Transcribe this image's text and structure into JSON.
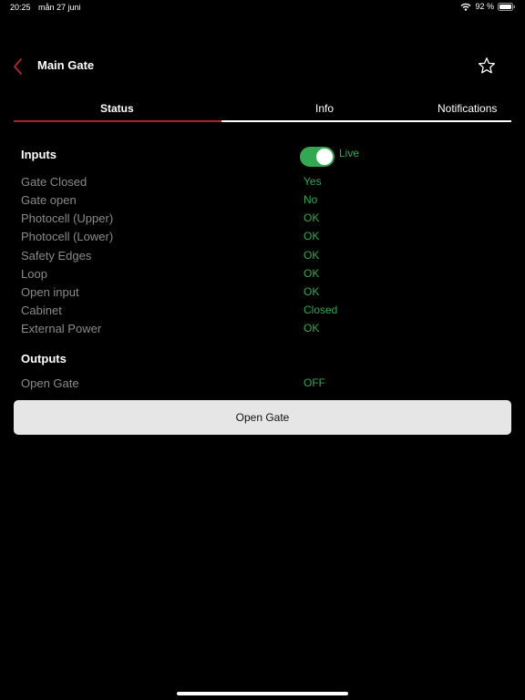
{
  "status_bar": {
    "time": "20:25",
    "date": "mån 27 juni",
    "battery_percent": "92 %",
    "icons": [
      "wifi-icon",
      "battery-icon"
    ]
  },
  "navbar": {
    "title": "Main Gate",
    "icons": [
      "chevron-left-icon",
      "star-icon"
    ],
    "accent_color": "#b0222d"
  },
  "tabs": [
    {
      "label": "Status",
      "selected": true
    },
    {
      "label": "Info",
      "selected": false
    },
    {
      "label": "Notifications",
      "selected": false
    }
  ],
  "inputs": {
    "title": "Inputs",
    "live_toggle_on": true,
    "live_label": "Live",
    "rows": [
      {
        "label": "Gate Closed",
        "value": "Yes"
      },
      {
        "label": "Gate open",
        "value": "No"
      },
      {
        "label": "Photocell (Upper)",
        "value": "OK"
      },
      {
        "label": "Photocell (Lower)",
        "value": "OK"
      },
      {
        "label": "Safety Edges",
        "value": "OK"
      },
      {
        "label": "Loop",
        "value": "OK"
      },
      {
        "label": "Open input",
        "value": "OK"
      },
      {
        "label": "Cabinet",
        "value": "Closed"
      },
      {
        "label": "External Power",
        "value": "OK"
      }
    ]
  },
  "outputs": {
    "title": "Outputs",
    "rows": [
      {
        "label": "Open Gate",
        "value": "OFF"
      }
    ]
  },
  "action_button": "Open Gate",
  "colors": {
    "background": "#000000",
    "status_green": "#32a852",
    "label_gray": "#8a8a8a",
    "button_bg": "#e6e6e6"
  }
}
